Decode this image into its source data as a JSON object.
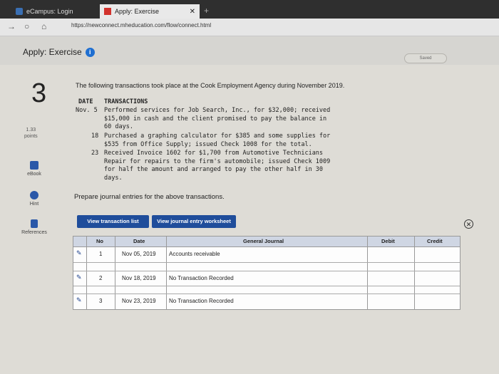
{
  "browser": {
    "tabs": [
      {
        "label": "eCampus: Login"
      },
      {
        "label": "Apply: Exercise"
      }
    ],
    "url": "https://newconnect.mheducation.com/flow/connect.html"
  },
  "app": {
    "title": "Apply: Exercise",
    "saved_label": "Saved"
  },
  "question": {
    "number": "3",
    "points_value": "1.33",
    "points_label": "points",
    "intro": "The following transactions took place at the Cook Employment Agency during November 2019.",
    "col_date": "DATE",
    "col_transactions": "TRANSACTIONS",
    "transactions": [
      {
        "date": "Nov. 5",
        "lines": [
          "Performed services for Job Search, Inc., for $32,000; received",
          "$15,000 in cash and the client promised to pay the balance in",
          "60 days."
        ]
      },
      {
        "date": "18",
        "lines": [
          "Purchased a graphing calculator for $385 and some supplies for",
          "$535 from Office Supply; issued Check 1008 for the total."
        ]
      },
      {
        "date": "23",
        "lines": [
          "Received Invoice 1602 for $1,700 from Automotive Technicians",
          "Repair for repairs to the firm's automobile; issued Check 1009",
          "for half the amount and arranged to pay the other half in 30",
          "days."
        ]
      }
    ],
    "prompt": "Prepare journal entries for the above transactions."
  },
  "sidebar": {
    "ebook": "eBook",
    "hint": "Hint",
    "references": "References"
  },
  "toolbar": {
    "view_transactions": "View transaction list",
    "view_worksheet": "View journal entry worksheet"
  },
  "journal": {
    "columns": {
      "no": "No",
      "date": "Date",
      "general_journal": "General Journal",
      "debit": "Debit",
      "credit": "Credit"
    },
    "rows": [
      {
        "no": "1",
        "date": "Nov 05, 2019",
        "account": "Accounts receivable"
      },
      {
        "no": "2",
        "date": "Nov 18, 2019",
        "account": "No Transaction Recorded"
      },
      {
        "no": "3",
        "date": "Nov 23, 2019",
        "account": "No Transaction Recorded"
      }
    ]
  },
  "colors": {
    "accent": "#1f4d9b",
    "info": "#1f6fd1"
  }
}
